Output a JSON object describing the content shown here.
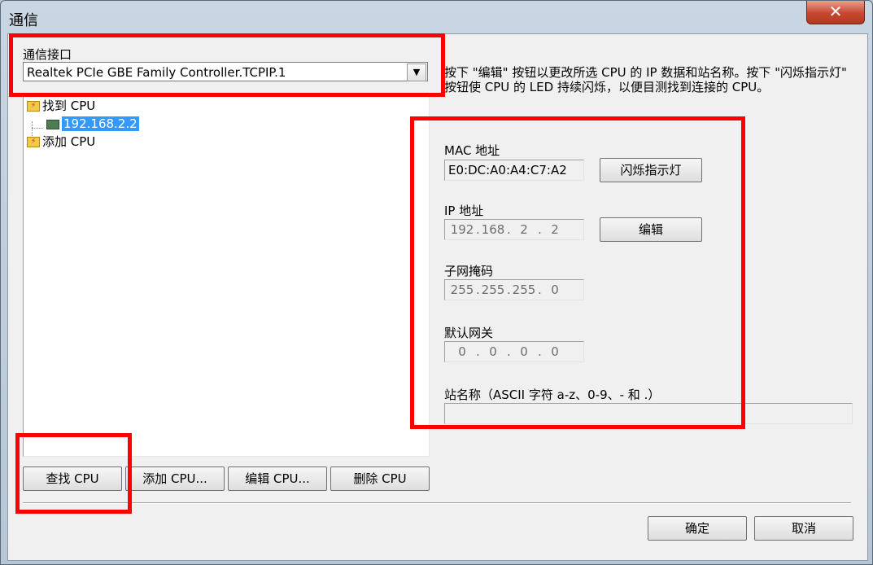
{
  "window": {
    "title": "通信",
    "close_label": "✕"
  },
  "interface": {
    "label": "通信接口",
    "selected": "Realtek PCIe GBE Family Controller.TCPIP.1"
  },
  "tree": {
    "found_label": "找到 CPU",
    "found_item": "192.168.2.2",
    "add_label": "添加 CPU"
  },
  "description": "按下 \"编辑\" 按钮以更改所选 CPU 的 IP 数据和站名称。按下 \"闪烁指示灯\" 按钮使 CPU 的 LED 持续闪烁，以便目测找到连接的 CPU。",
  "details": {
    "mac_label": "MAC 地址",
    "mac_value": "E0:DC:A0:A4:C7:A2",
    "blink_button": "闪烁指示灯",
    "ip_label": "IP 地址",
    "ip": [
      "192",
      "168",
      "2",
      "2"
    ],
    "edit_button": "编辑",
    "subnet_label": "子网掩码",
    "subnet": [
      "255",
      "255",
      "255",
      "0"
    ],
    "gateway_label": "默认网关",
    "gateway": [
      "0",
      "0",
      "0",
      "0"
    ],
    "station_label": "站名称（ASCII 字符 a-z、0-9、- 和 .）",
    "station_value": ""
  },
  "buttons": {
    "find_cpu": "查找 CPU",
    "add_cpu": "添加 CPU...",
    "edit_cpu": "编辑 CPU...",
    "delete_cpu": "删除 CPU",
    "ok": "确定",
    "cancel": "取消"
  },
  "colors": {
    "highlight_box": "#ff0000",
    "selection": "#3399ff"
  }
}
